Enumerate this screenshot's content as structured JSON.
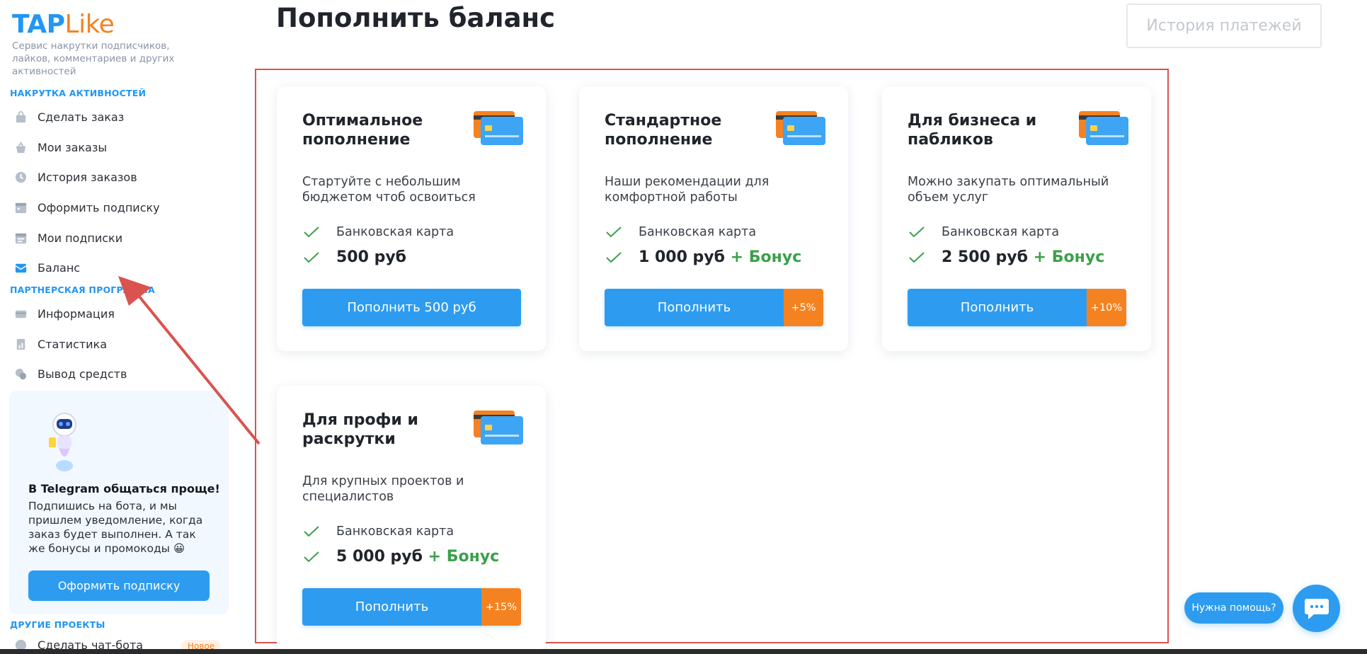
{
  "logo": {
    "part1": "TAP",
    "part2": "Like"
  },
  "sidebar": {
    "tagline": "Сервис накрутки подписчиков, лайков, комментариев и других активностей",
    "section_activity": "НАКРУТКА АКТИВНОСТЕЙ",
    "activity_items": [
      {
        "label": "Сделать заказ",
        "icon": "bag-icon"
      },
      {
        "label": "Мои заказы",
        "icon": "basket-icon"
      },
      {
        "label": "История заказов",
        "icon": "clock-icon"
      },
      {
        "label": "Оформить подписку",
        "icon": "calendar-icon"
      },
      {
        "label": "Мои подписки",
        "icon": "calendar-list-icon"
      },
      {
        "label": "Баланс",
        "icon": "wallet-icon",
        "active": true
      }
    ],
    "section_partner": "ПАРТНЕРСКАЯ ПРОГРАММА",
    "partner_items": [
      {
        "label": "Информация",
        "icon": "info-card-icon"
      },
      {
        "label": "Статистика",
        "icon": "chart-icon"
      },
      {
        "label": "Вывод средств",
        "icon": "coins-icon"
      }
    ],
    "telegram": {
      "title": "В Telegram общаться проще!",
      "text": "Подпишись на бота, и мы пришлем уведомление, когда заказ будет выполнен. А так же бонусы и промокоды 😀",
      "button": "Оформить подписку"
    },
    "section_other": "ДРУГИЕ ПРОЕКТЫ",
    "other_item": {
      "label": "Сделать чат-бота",
      "badge": "Новое"
    }
  },
  "header": {
    "title": "Пополнить баланс",
    "history_button": "История платежей"
  },
  "plans": [
    {
      "title": "Оптимальное пополнение",
      "desc": "Стартуйте с небольшим бюджетом чтоб освоиться",
      "method": "Банковская карта",
      "amount": "500 руб",
      "bonus": "",
      "button": "Пополнить 500 руб",
      "badge": ""
    },
    {
      "title": "Стандартное пополнение",
      "desc": "Наши рекомендации для комфортной работы",
      "method": "Банковская карта",
      "amount": "1 000 руб",
      "bonus": "+ Бонус",
      "button": "Пополнить",
      "badge": "+5%"
    },
    {
      "title": "Для бизнеса и пабликов",
      "desc": "Можно закупать оптимальный объем услуг",
      "method": "Банковская карта",
      "amount": "2 500 руб",
      "bonus": "+ Бонус",
      "button": "Пополнить",
      "badge": "+10%"
    },
    {
      "title": "Для профи и раскрутки",
      "desc": "Для крупных проектов и специалистов",
      "method": "Банковская карта",
      "amount": "5 000 руб",
      "bonus": "+ Бонус",
      "button": "Пополнить",
      "badge": "+15%"
    }
  ],
  "help": {
    "label": "Нужна помощь?"
  },
  "colors": {
    "brand_blue": "#2196f3",
    "brand_orange": "#f58220",
    "bonus_green": "#3aa04a",
    "annotation_red": "#d9534f"
  }
}
